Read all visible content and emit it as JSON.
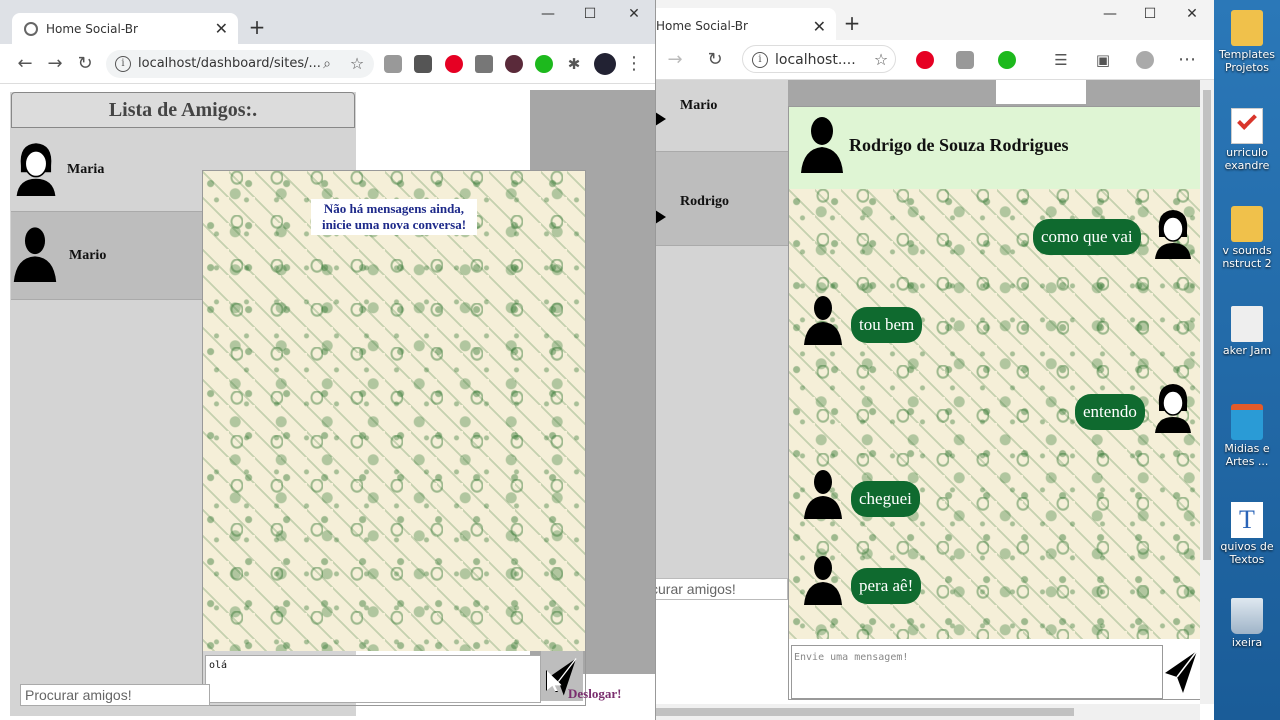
{
  "desktop": {
    "icons": [
      {
        "label": "Templates\nProjetos"
      },
      {
        "label": "urriculo\nexandre"
      },
      {
        "label": "v sounds\nnstruct 2"
      },
      {
        "label": "aker Jam"
      },
      {
        "label": "Midias e\nArtes ..."
      },
      {
        "label": "quivos de\nTextos"
      },
      {
        "label": "ixeira"
      }
    ]
  },
  "left_window": {
    "tab_title": "Home Social-Br",
    "url": "localhost/dashboard/sites/...",
    "friends_header": "Lista de Amigos:.",
    "friends": [
      {
        "name": "Maria"
      },
      {
        "name": "Mario"
      }
    ],
    "empty_message": "Não há mensagens ainda, inicie uma nova conversa!",
    "message_input_value": "olá",
    "search_placeholder": "Procurar amigos!",
    "logout_label": "Deslogar!"
  },
  "right_window": {
    "tab_title": "Home Social-Br",
    "url": "localhost....",
    "friends": [
      {
        "name": "Mario"
      },
      {
        "name": "Rodrigo"
      }
    ],
    "search_placeholder": "curar amigos!",
    "chat_header_name": "Rodrigo de Souza Rodrigues",
    "messages": [
      {
        "text": "como que vai",
        "side": "right",
        "avatar": "female"
      },
      {
        "text": "tou bem",
        "side": "left",
        "avatar": "male"
      },
      {
        "text": "entendo",
        "side": "right",
        "avatar": "female"
      },
      {
        "text": "cheguei",
        "side": "left",
        "avatar": "male"
      },
      {
        "text": "pera aê!",
        "side": "left",
        "avatar": "male"
      }
    ],
    "message_placeholder": "Envie uma mensagem!"
  },
  "colors": {
    "bubble": "#0f6a2f",
    "chat_header": "#dff5d4",
    "empty_message_text": "#1e2a8a"
  }
}
